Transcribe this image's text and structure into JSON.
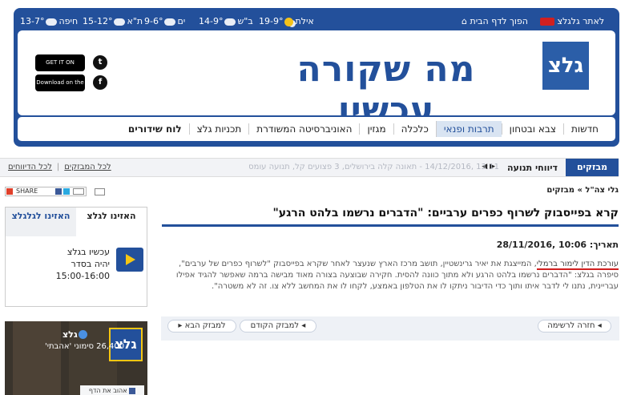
{
  "header": {
    "weather": [
      {
        "city": "חיפה",
        "temp": "13-7°"
      },
      {
        "city": "ת\"א",
        "temp": "15-12°"
      },
      {
        "city": "ים",
        "temp": "9-6°"
      },
      {
        "city": "ב\"ש",
        "temp": "14-9°"
      },
      {
        "city": "אילת",
        "temp": "19-9°"
      }
    ],
    "homepage_link": "הפוך לדף הבית",
    "site_link": "לאתר גלגלצ",
    "logo_text": "גלצ",
    "title": "מה שקורה עכשיו",
    "google_play": "GET IT ON Google Play",
    "app_store": "Download on the App Store"
  },
  "nav": {
    "items": [
      {
        "label": "חדשות",
        "active": false,
        "bold": false
      },
      {
        "label": "צבא ובטחון",
        "active": false,
        "bold": false
      },
      {
        "label": "תרבות ופנאי",
        "active": true,
        "bold": false
      },
      {
        "label": "כלכלה",
        "active": false,
        "bold": false
      },
      {
        "label": "מגזין",
        "active": false,
        "bold": false
      },
      {
        "label": "האוניברסיטה המשודרת",
        "active": false,
        "bold": false
      },
      {
        "label": "תכניות גלצ",
        "active": false,
        "bold": false
      },
      {
        "label": "לוח שידורים",
        "active": false,
        "bold": true
      }
    ]
  },
  "ticker": {
    "tab": "מבזקים",
    "label": "דיווחי תנועה",
    "text": "13:11 ,14/12/2016 - תאונה קלה בירושלים, 3 פצועים קל, תנועה עומס",
    "link_all_news": "לכל המבזקים",
    "link_all_reports": "לכל הדיווחים"
  },
  "share": {
    "label": "SHARE"
  },
  "breadcrumb": "גלי צה\"ל » מבזקים",
  "article": {
    "title": "קרא בפייסבוק לשרוף כפרים ערביים: \"הדברים נרשמו בלהט הרגע\"",
    "date_label": "תאריך:",
    "date_value": "10:06 ,28/11/2016",
    "body_highlight": "עורכת הדין לימור ברמלי",
    "body_rest": ", המייצגת את יאיר גרינשטיין, תושב מרכז הארץ שנעצר לאחר שקרא בפייסבוק \"לשרוף כפרים של ערבים\", סיפרה בגלצ: \"הדברים נרשמו בלהט הרגע ולא מתוך כוונה להסית. חקירה שבוצעה בצורה מאוד מבישה ברמה שאפשר להגיד אפילו עבריינית, נתנו לי לדבר איתו ותוך כדי הדיבור ניתקו לו את הטלפון באמצע, לקחו לו את המחשב ללא צו. זה לא משטרה\"."
  },
  "article_nav": {
    "back": "חזרה לרשימה",
    "prev": "למבזק הקודם",
    "next": "למבזק הבא"
  },
  "radio": {
    "tab1": "האזינו לגלצ",
    "tab2": "האזינו לגלגלצ",
    "now_label": "עכשיו בגלצ",
    "show": "יהיה בסדר",
    "hours": "15:00-16:00"
  },
  "facebook": {
    "page_name": "גלצ",
    "likes": "26,400 סימוני 'אהבתי'",
    "like_button": "אהוב את הדף"
  },
  "colors": {
    "brand_blue": "#23509b",
    "brand_yellow": "#f6c613",
    "highlight_red": "#d02020"
  }
}
